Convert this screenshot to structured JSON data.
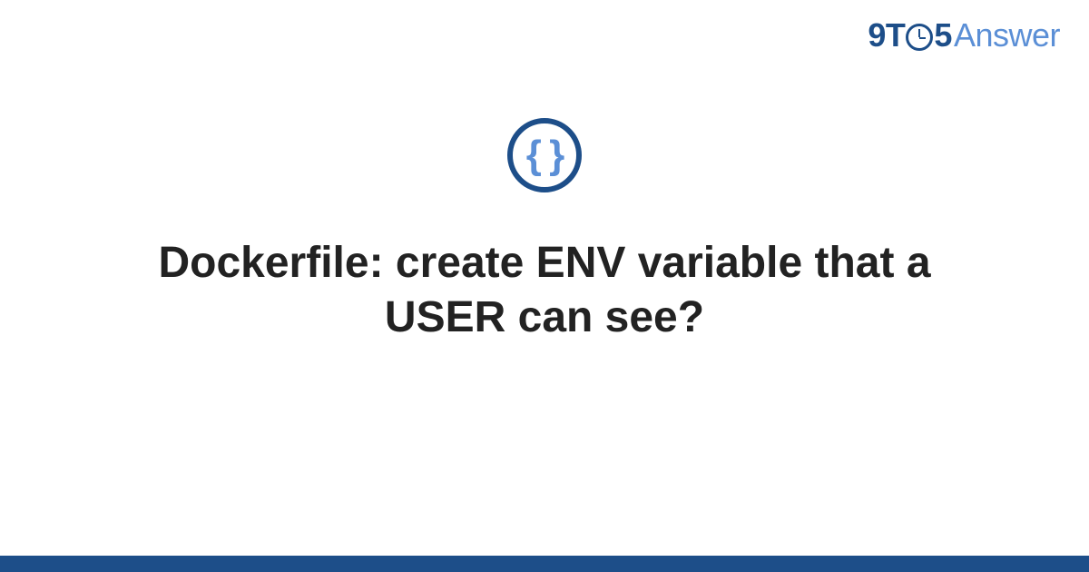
{
  "logo": {
    "part1": "9T",
    "part2": "5",
    "part3": "Answer"
  },
  "category_icon": {
    "glyph": "{ }",
    "semantic": "code-braces-icon"
  },
  "title": "Dockerfile: create ENV variable that a USER can see?",
  "colors": {
    "brand_dark": "#1d4e89",
    "brand_light": "#5b8fd6",
    "text": "#222222"
  }
}
